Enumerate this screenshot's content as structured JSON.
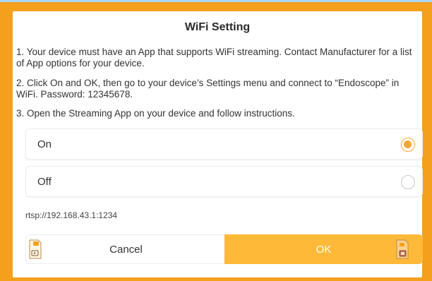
{
  "dialog": {
    "title": "WiFi Setting",
    "instructions": [
      "1. Your device must have an App that supports WiFi streaming. Contact Manufacturer for a list of App options for your device.",
      "2. Click On and OK, then go to your device’s Settings menu and connect to “Endoscope” in WiFi. Password: 12345678.",
      "3. Open the Streaming App on your device and follow instructions."
    ],
    "options": [
      {
        "label": "On",
        "selected": true
      },
      {
        "label": "Off",
        "selected": false
      }
    ],
    "stream_url": "rtsp://192.168.43.1:1234",
    "buttons": {
      "cancel": "Cancel",
      "ok": "OK"
    }
  },
  "icons": {
    "cancel_sticker": "camera-doc-icon",
    "ok_sticker": "camera-doc-icon"
  },
  "colors": {
    "frame": "#f4a01c",
    "accent": "#f7a833",
    "ok_button": "#ffb938",
    "background_top": "#a9d6f3"
  }
}
